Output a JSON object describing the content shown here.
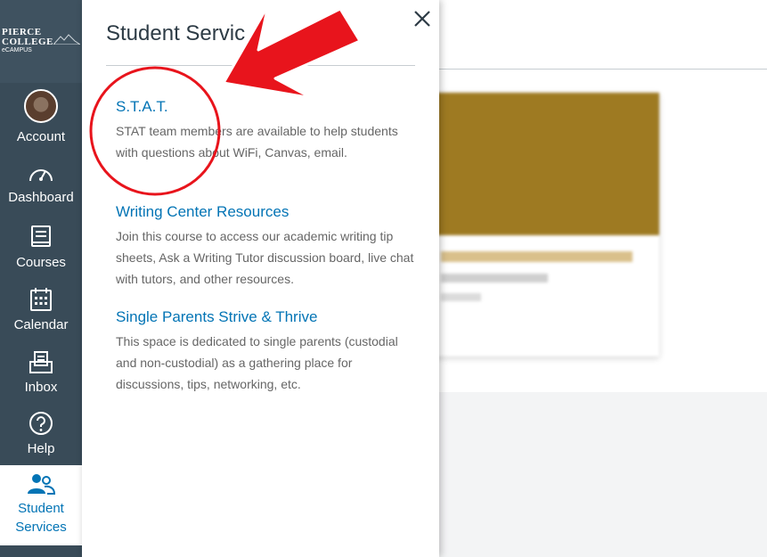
{
  "logo": {
    "line1": "PIERCE",
    "line2": "COLLEGE",
    "line3": "eCAMPUS"
  },
  "nav": [
    {
      "label": "Account",
      "icon": "avatar"
    },
    {
      "label": "Dashboard",
      "icon": "dashboard-icon"
    },
    {
      "label": "Courses",
      "icon": "courses-icon"
    },
    {
      "label": "Calendar",
      "icon": "calendar-icon"
    },
    {
      "label": "Inbox",
      "icon": "inbox-icon"
    },
    {
      "label": "Help",
      "icon": "help-icon"
    },
    {
      "label_line1": "Student",
      "label_line2": "Services",
      "icon": "people-icon",
      "active": true
    }
  ],
  "tray": {
    "title": "Student Servic",
    "close_label": "close",
    "services": [
      {
        "title": "S.T.A.T.",
        "description": "STAT team members are available to help students with questions about WiFi, Canvas, email."
      },
      {
        "title": "Writing Center Resources",
        "description": "Join this course to access our academic writing tip sheets, Ask a Writing Tutor discussion board, live chat with tutors, and other resources."
      },
      {
        "title": "Single Parents Strive & Thrive",
        "description": "This space is dedicated to single parents (custodial and non-custodial) as a gathering place for discussions, tips, networking, etc."
      }
    ]
  },
  "colors": {
    "nav_bg": "#394B58",
    "link": "#0374B5",
    "annotation": "#E8141C",
    "card_image": "#9E7A22"
  }
}
